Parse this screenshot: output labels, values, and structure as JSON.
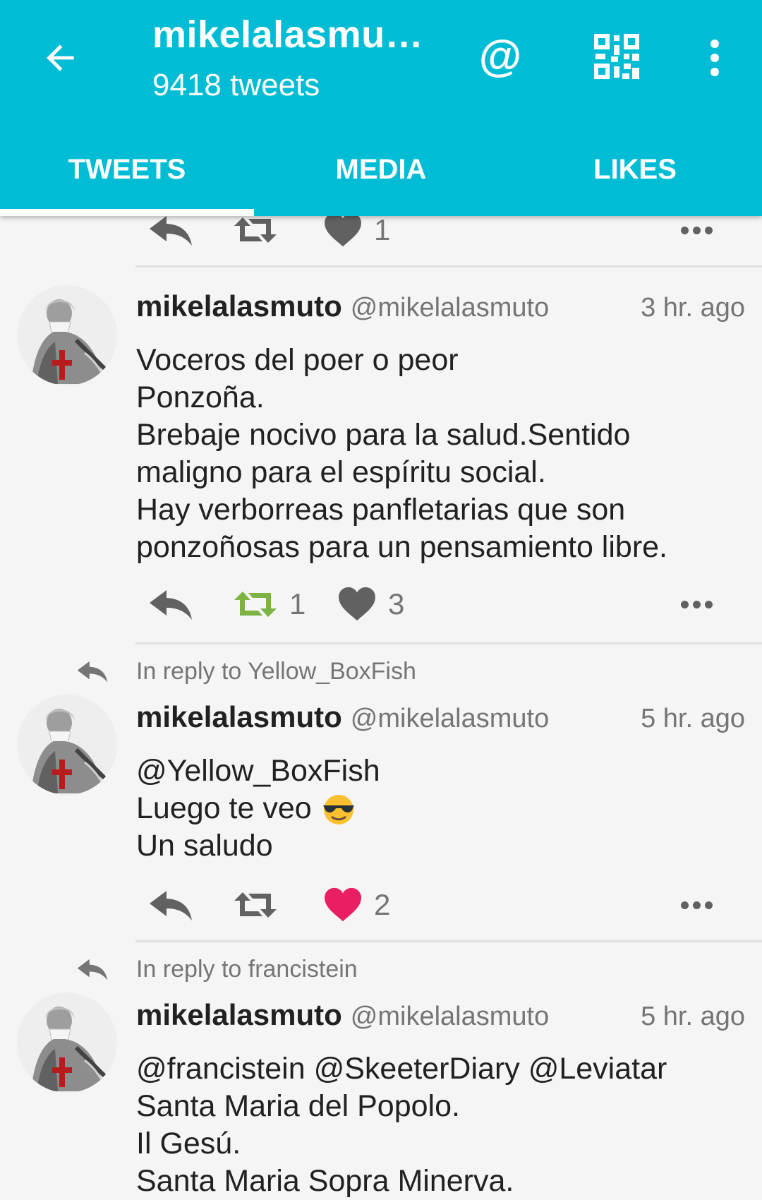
{
  "header": {
    "title": "mikelalasmu…",
    "subtitle": "9418 tweets",
    "colors": {
      "primary": "#00bcd4",
      "accent_like": "#e91e63",
      "accent_retweet": "#7cb342"
    }
  },
  "tabs": [
    {
      "label": "TWEETS",
      "active": true
    },
    {
      "label": "MEDIA",
      "active": false
    },
    {
      "label": "LIKES",
      "active": false
    }
  ],
  "partial_tweet": {
    "likes": "1"
  },
  "tweets": [
    {
      "name": "mikelalasmuto",
      "handle": "@mikelalasmuto",
      "time": "3 hr. ago",
      "lines": [
        "Voceros del poer o peor",
        "Ponzoña.",
        "Brebaje nocivo para la salud.Sentido",
        "maligno para el espíritu social.",
        "Hay verborreas panfletarias que son",
        "ponzoñosas para un pensamiento libre."
      ],
      "retweets": "1",
      "likes": "3"
    },
    {
      "reply_to": "In reply to Yellow_BoxFish",
      "name": "mikelalasmuto",
      "handle": "@mikelalasmuto",
      "time": "5 hr. ago",
      "lines": [
        "@Yellow_BoxFish",
        "Luego te veo",
        "Un saludo"
      ],
      "emoji": "sunglasses-emoji",
      "likes": "2"
    },
    {
      "reply_to": "In reply to francistein",
      "name": "mikelalasmuto",
      "handle": "@mikelalasmuto",
      "time": "5 hr. ago",
      "lines": [
        "@francistein @SkeeterDiary @Leviatar",
        "Santa Maria del Popolo.",
        "Il Gesú.",
        "Santa Maria Sopra Minerva."
      ]
    }
  ]
}
